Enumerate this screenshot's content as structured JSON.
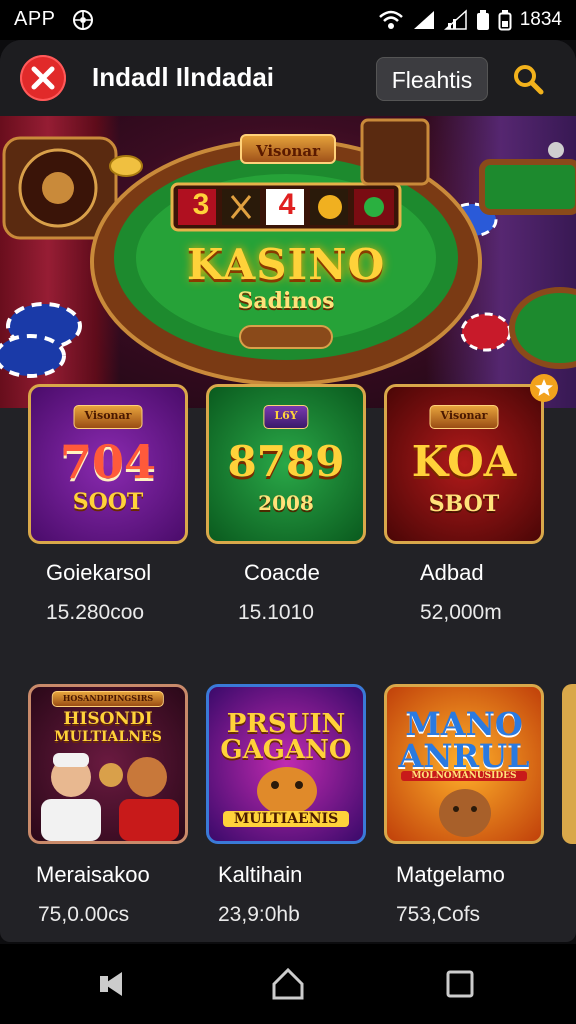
{
  "status_bar": {
    "app_label": "APP",
    "time": "1834"
  },
  "header": {
    "title": "Indadl  Ilndadai",
    "button_label": "Fleahtis"
  },
  "hero": {
    "plaque": "Visonar",
    "title": "KASINO",
    "subtitle": "Sadinos",
    "reels": [
      "3",
      "",
      "4",
      "",
      ""
    ]
  },
  "games": [
    {
      "tile_plaque": "Visonar",
      "tile_big": "704",
      "tile_small": "SOOT",
      "name": "Goiekarsol",
      "value": "15.280coo"
    },
    {
      "tile_plaque": "L6Y",
      "tile_big": "8789",
      "tile_small": "2008",
      "name": "Coacde",
      "value": "15.1010"
    },
    {
      "tile_plaque": "Visonar",
      "tile_big": "KOA",
      "tile_small": "SBOT",
      "name": "Adbad",
      "value": "52,000m"
    },
    {
      "tile_plaque": "HOSANDIPINGSIRS",
      "tile_big": "HISONDI",
      "tile_small": "MULTIALNES",
      "name": "Meraisakoo",
      "value": "75,0.00cs"
    },
    {
      "tile_plaque": "",
      "tile_big": "PRSUIN",
      "tile_small": "GAGANO",
      "tile_banner": "MULTIAENIS",
      "name": "Kaltihain",
      "value": "23,9:0hb"
    },
    {
      "tile_plaque": "",
      "tile_big": "MANO",
      "tile_small": "ANRUL",
      "tile_banner": "MOLNOMANUSIDES",
      "name": "Matgelamo",
      "value": "753,Cofs"
    }
  ],
  "colors": {
    "accent": "#d9a84a",
    "close": "#e12a2a",
    "search": "#f2b21c"
  }
}
